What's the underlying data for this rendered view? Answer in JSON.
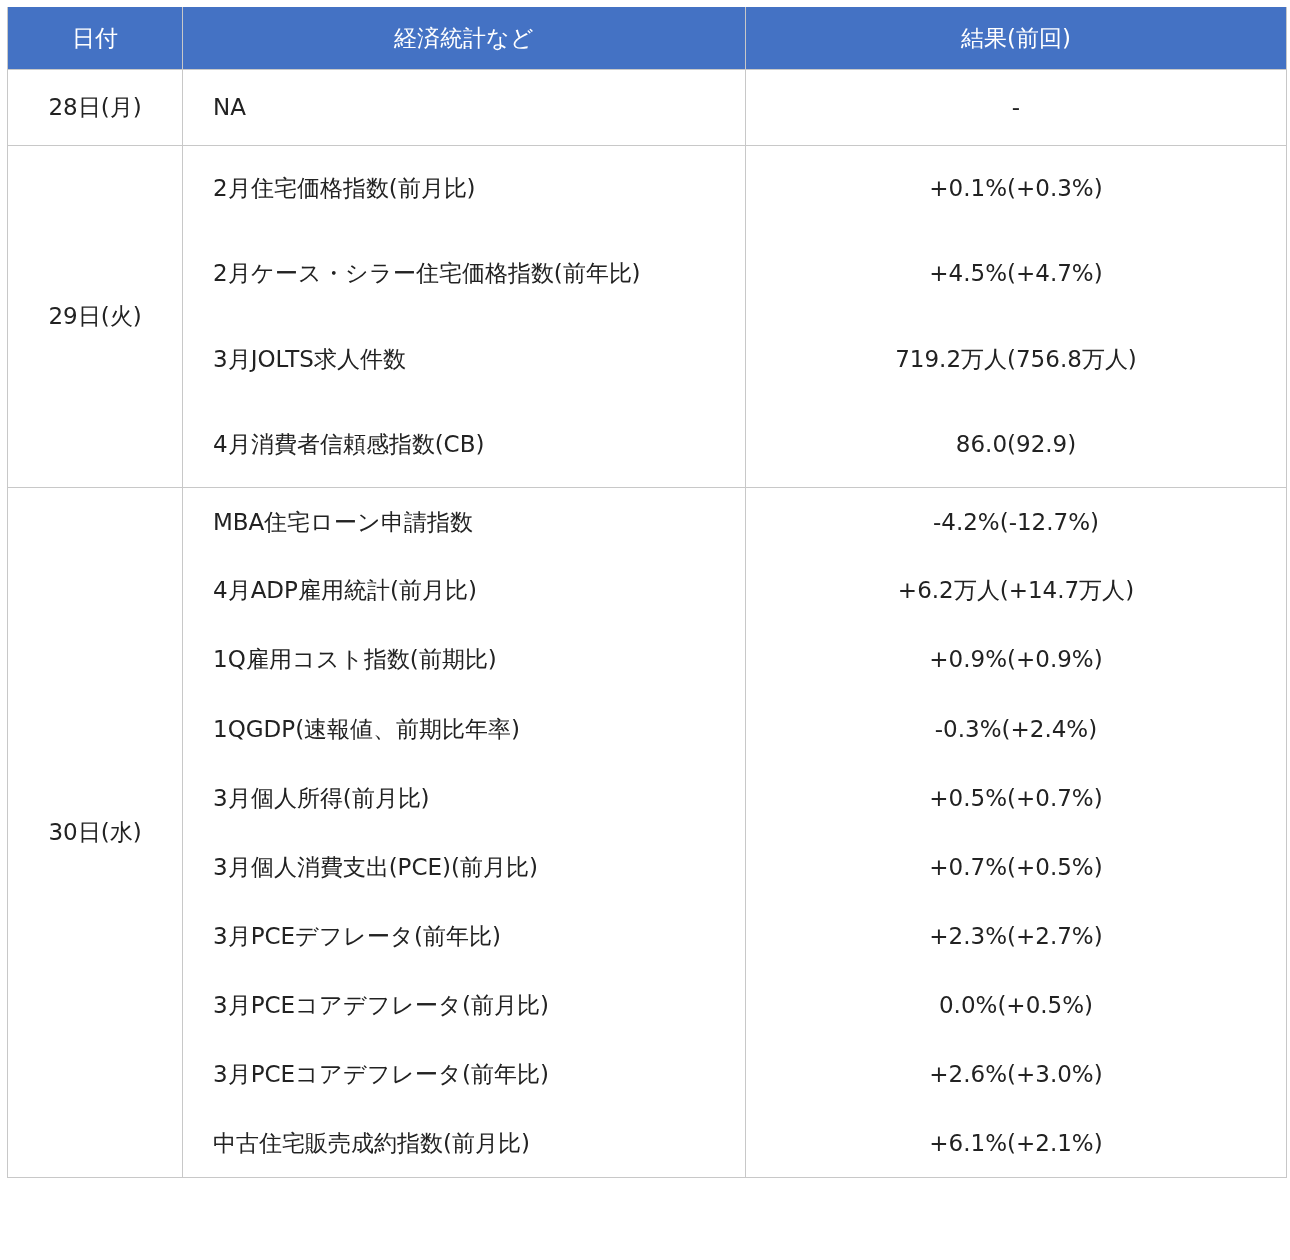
{
  "table": {
    "columns": [
      "日付",
      "経済統計など",
      "結果(前回)"
    ],
    "rows": [
      {
        "date": "28日(月)",
        "items": [
          {
            "indicator": "NA",
            "result": "-"
          }
        ]
      },
      {
        "date": "29日(火)",
        "items": [
          {
            "indicator": "2月住宅価格指数(前月比)",
            "result": "+0.1%(+0.3%)"
          },
          {
            "indicator": "2月ケース・シラー住宅価格指数(前年比)",
            "result": "+4.5%(+4.7%)"
          },
          {
            "indicator": "3月JOLTS求人件数",
            "result": "719.2万人(756.8万人)"
          },
          {
            "indicator": "4月消費者信頼感指数(CB)",
            "result": "86.0(92.9)"
          }
        ]
      },
      {
        "date": "30日(水)",
        "items": [
          {
            "indicator": "MBA住宅ローン申請指数",
            "result": "-4.2%(-12.7%)"
          },
          {
            "indicator": "4月ADP雇用統計(前月比)",
            "result": "+6.2万人(+14.7万人)"
          },
          {
            "indicator": "1Q雇用コスト指数(前期比)",
            "result": "+0.9%(+0.9%)"
          },
          {
            "indicator": "1QGDP(速報値、前期比年率)",
            "result": "-0.3%(+2.4%)"
          },
          {
            "indicator": "3月個人所得(前月比)",
            "result": "+0.5%(+0.7%)"
          },
          {
            "indicator": "3月個人消費支出(PCE)(前月比)",
            "result": "+0.7%(+0.5%)"
          },
          {
            "indicator": "3月PCEデフレータ(前年比)",
            "result": "+2.3%(+2.7%)"
          },
          {
            "indicator": "3月PCEコアデフレータ(前月比)",
            "result": "0.0%(+0.5%)"
          },
          {
            "indicator": "3月PCEコアデフレータ(前年比)",
            "result": "+2.6%(+3.0%)"
          },
          {
            "indicator": "中古住宅販売成約指数(前月比)",
            "result": "+6.1%(+2.1%)"
          }
        ]
      }
    ]
  }
}
